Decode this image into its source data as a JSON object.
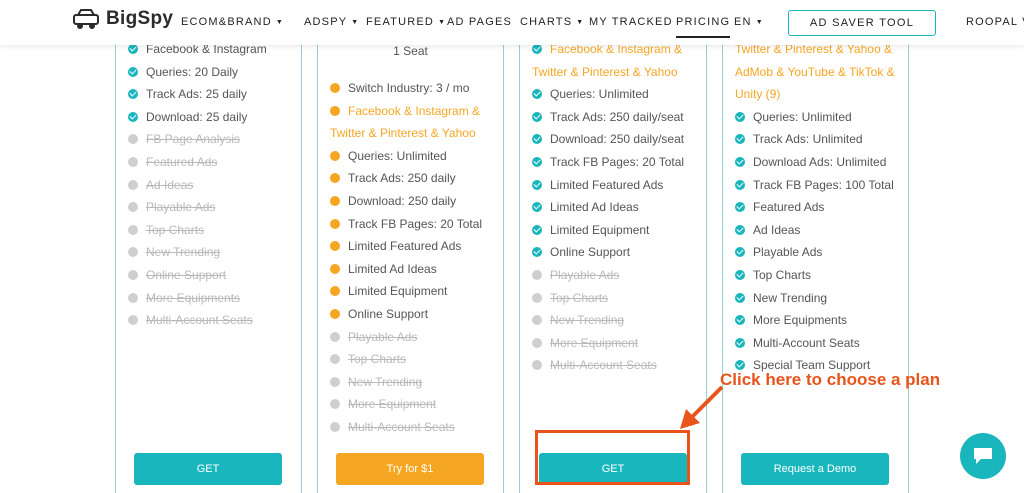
{
  "nav": {
    "logo": "BigSpy",
    "items": [
      "ECOM&BRAND",
      "ADSPY",
      "FEATURED",
      "AD PAGES",
      "CHARTS",
      "MY TRACKED",
      "PRICING",
      "EN"
    ],
    "saver_button": "AD SAVER TOOL",
    "user": "ROOPAL VI"
  },
  "plans": [
    {
      "features": [
        {
          "text": "Facebook & Instagram",
          "state": "on"
        },
        {
          "text": "Queries: 20 Daily",
          "state": "on"
        },
        {
          "text": "Track Ads: 25 daily",
          "state": "on"
        },
        {
          "text": "Download: 25 daily",
          "state": "on"
        },
        {
          "text": "FB Page Analysis",
          "state": "off"
        },
        {
          "text": "Featured Ads",
          "state": "off"
        },
        {
          "text": "Ad Ideas",
          "state": "off"
        },
        {
          "text": "Playable Ads",
          "state": "off"
        },
        {
          "text": "Top Charts",
          "state": "off"
        },
        {
          "text": "New Trending",
          "state": "off"
        },
        {
          "text": "Online Support",
          "state": "off"
        },
        {
          "text": "More Equipments",
          "state": "off"
        },
        {
          "text": "Multi-Account Seats",
          "state": "off"
        }
      ],
      "button": "GET"
    },
    {
      "seat": "1 Seat",
      "features": [
        {
          "text": "Switch Industry: 3 / mo",
          "state": "on"
        },
        {
          "text": "Facebook & Instagram &",
          "state": "hl"
        },
        {
          "text": "Twitter & Pinterest & Yahoo",
          "state": "hl-cont"
        },
        {
          "text": "Queries: Unlimited",
          "state": "on"
        },
        {
          "text": "Track Ads: 250 daily",
          "state": "on"
        },
        {
          "text": "Download: 250 daily",
          "state": "on"
        },
        {
          "text": "Track FB Pages: 20 Total",
          "state": "on"
        },
        {
          "text": "Limited Featured Ads",
          "state": "on"
        },
        {
          "text": "Limited Ad Ideas",
          "state": "on"
        },
        {
          "text": "Limited Equipment",
          "state": "on"
        },
        {
          "text": "Online Support",
          "state": "on"
        },
        {
          "text": "Playable Ads",
          "state": "off"
        },
        {
          "text": "Top Charts",
          "state": "off"
        },
        {
          "text": "New Trending",
          "state": "off"
        },
        {
          "text": "More Equipment",
          "state": "off"
        },
        {
          "text": "Multi-Account Seats",
          "state": "off"
        }
      ],
      "button": "Try for $1"
    },
    {
      "features": [
        {
          "text": "Facebook & Instagram &",
          "state": "hl"
        },
        {
          "text": "Twitter & Pinterest & Yahoo",
          "state": "hl-cont"
        },
        {
          "text": "Queries: Unlimited",
          "state": "on"
        },
        {
          "text": "Track Ads: 250 daily/seat",
          "state": "on"
        },
        {
          "text": "Download: 250 daily/seat",
          "state": "on"
        },
        {
          "text": "Track FB Pages: 20 Total",
          "state": "on"
        },
        {
          "text": "Limited Featured Ads",
          "state": "on"
        },
        {
          "text": "Limited Ad Ideas",
          "state": "on"
        },
        {
          "text": "Limited Equipment",
          "state": "on"
        },
        {
          "text": "Online Support",
          "state": "on"
        },
        {
          "text": "Playable Ads",
          "state": "off"
        },
        {
          "text": "Top Charts",
          "state": "off"
        },
        {
          "text": "New Trending",
          "state": "off"
        },
        {
          "text": "More Equipment",
          "state": "off"
        },
        {
          "text": "Multi-Account Seats",
          "state": "off"
        }
      ],
      "button": "GET"
    },
    {
      "features": [
        {
          "text": "Twitter & Pinterest & Yahoo &",
          "state": "hl-cont"
        },
        {
          "text": "AdMob & YouTube & TikTok &",
          "state": "hl-cont"
        },
        {
          "text": "Unity  (9)",
          "state": "hl-cont"
        },
        {
          "text": "Queries: Unlimited",
          "state": "on"
        },
        {
          "text": "Track Ads: Unlimited",
          "state": "on"
        },
        {
          "text": "Download Ads: Unlimited",
          "state": "on"
        },
        {
          "text": "Track FB Pages: 100 Total",
          "state": "on"
        },
        {
          "text": "Featured Ads",
          "state": "on"
        },
        {
          "text": "Ad Ideas",
          "state": "on"
        },
        {
          "text": "Playable Ads",
          "state": "on"
        },
        {
          "text": "Top Charts",
          "state": "on"
        },
        {
          "text": "New Trending",
          "state": "on"
        },
        {
          "text": "More Equipments",
          "state": "on"
        },
        {
          "text": "Multi-Account Seats",
          "state": "on"
        },
        {
          "text": "Special Team Support",
          "state": "on"
        }
      ],
      "button": "Request a Demo"
    }
  ],
  "annotation": {
    "text": "Click here to choose a plan"
  },
  "colors": {
    "teal": "#19b6bd",
    "orange": "#f5a623",
    "annotation": "#e8541c"
  },
  "icons": {
    "chat": "chat-icon",
    "logo": "car-logo-icon"
  }
}
